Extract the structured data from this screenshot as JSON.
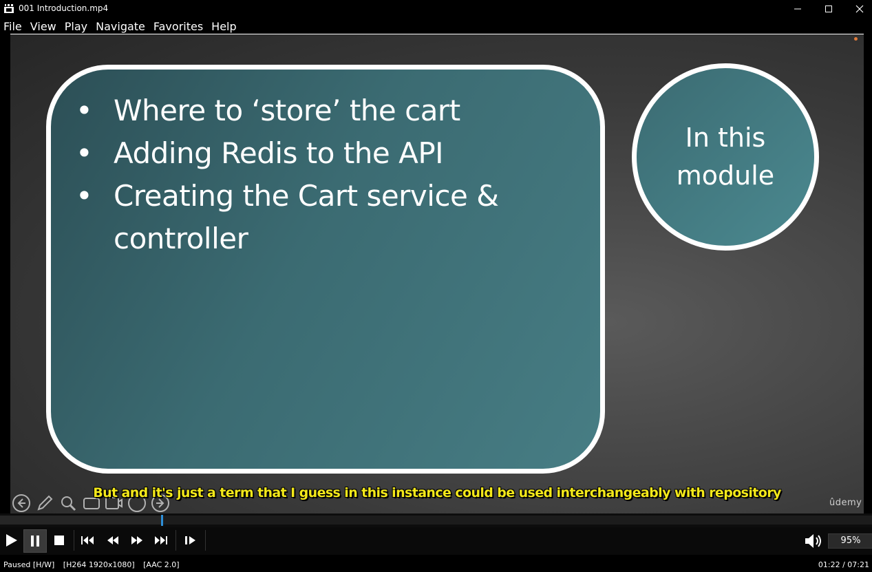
{
  "window": {
    "title": "001 Introduction.mp4",
    "minimize_glyph": "—",
    "maximize_glyph": "☐",
    "close_glyph": "✕"
  },
  "menu": [
    "File",
    "View",
    "Play",
    "Navigate",
    "Favorites",
    "Help"
  ],
  "slide": {
    "bullets": [
      "Where to ‘store’ the cart",
      "Adding Redis to the API",
      "Creating the Cart service & controller"
    ],
    "circle_text": "In this module",
    "watermark": "ûdemy"
  },
  "subtitle": "But and it's just a term that I guess in this instance could be used interchangeably with repository",
  "overlay_tools": [
    "back-arrow-icon",
    "pen-icon",
    "zoom-icon",
    "captions-icon",
    "screen-icon",
    "more-icon",
    "forward-arrow-icon"
  ],
  "playback": {
    "progress": 0.185,
    "volume": "95%",
    "buttons": [
      "play-icon",
      "pause-icon",
      "stop-icon",
      "skip-previous-icon",
      "rewind-icon",
      "fast-forward-icon",
      "skip-next-icon",
      "frame-step-icon"
    ]
  },
  "status": {
    "state": "Paused [H/W]",
    "video": "[H264 1920x1080]",
    "audio": "[AAC 2.0]",
    "time": "01:22 / 07:21"
  },
  "colors": {
    "subtitle": "#f3e81a",
    "seek_head": "#2d8fd8",
    "slide_teal": "#3b6b72"
  }
}
